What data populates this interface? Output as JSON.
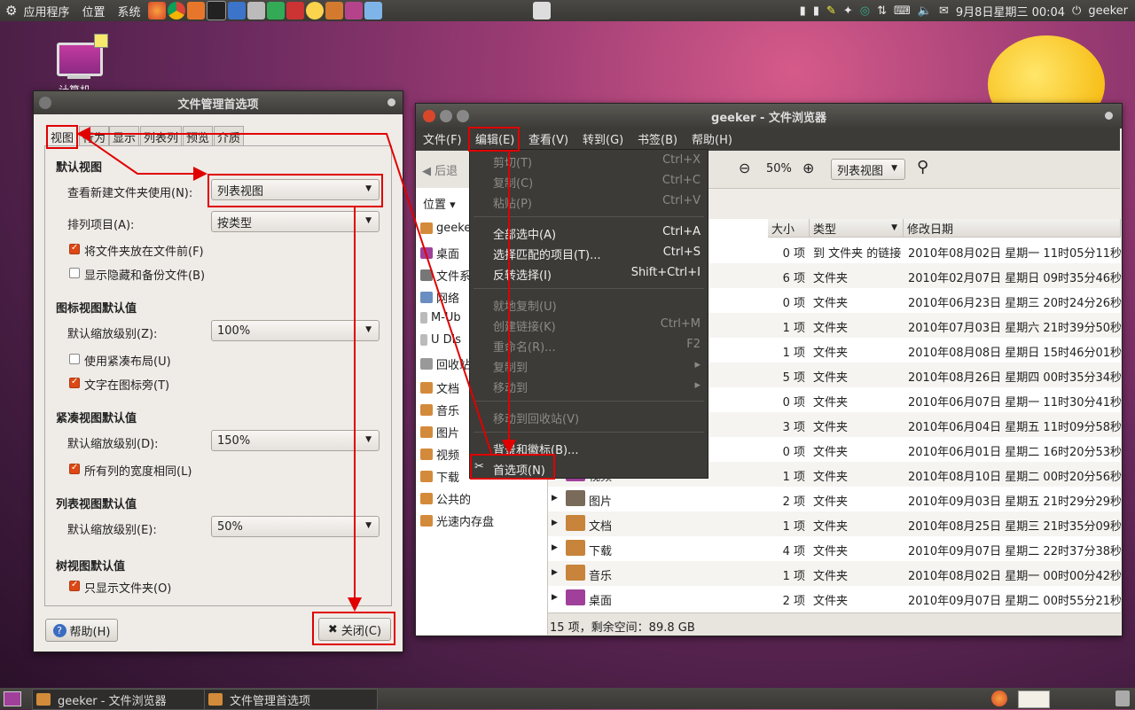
{
  "top_panel": {
    "menus": [
      "应用程序",
      "位置",
      "系统"
    ],
    "clock": "9月8日星期三 00:04",
    "user": "geeker"
  },
  "desktop": {
    "computer_label": "计算机"
  },
  "prefs": {
    "title": "文件管理首选项",
    "tabs": [
      "视图",
      "行为",
      "显示",
      "列表列",
      "预览",
      "介质"
    ],
    "g_default": "默认视图",
    "new_folder_label": "查看新建文件夹使用(N):",
    "new_folder_value": "列表视图",
    "sort_label": "排列项目(A):",
    "sort_value": "按类型",
    "folders_first": "将文件夹放在文件前(F)",
    "show_hidden": "显示隐藏和备份文件(B)",
    "g_icon": "图标视图默认值",
    "icon_zoom_label": "默认缩放级别(Z):",
    "icon_zoom_value": "100%",
    "compact": "使用紧凑布局(U)",
    "text_beside": "文字在图标旁(T)",
    "g_compact": "紧凑视图默认值",
    "compact_zoom_label": "默认缩放级别(D):",
    "compact_zoom_value": "150%",
    "same_width": "所有列的宽度相同(L)",
    "g_list": "列表视图默认值",
    "list_zoom_label": "默认缩放级别(E):",
    "list_zoom_value": "50%",
    "g_tree": "树视图默认值",
    "folders_only": "只显示文件夹(O)",
    "help": "帮助(H)",
    "close": "关闭(C)"
  },
  "browser": {
    "title": "geeker - 文件浏览器",
    "menubar": [
      "文件(F)",
      "编辑(E)",
      "查看(V)",
      "转到(G)",
      "书签(B)",
      "帮助(H)"
    ],
    "back": "后退",
    "zoom": "50%",
    "view_mode": "列表视图",
    "places_label": "位置",
    "sidebar": [
      "geeker",
      "桌面",
      "文件系统",
      "网络",
      "M-Ub",
      "U Dis",
      "回收站",
      "文档",
      "音乐",
      "图片",
      "视频",
      "下载",
      "公共的",
      "光速内存盘"
    ],
    "columns": [
      "大小",
      "类型",
      "修改日期"
    ],
    "rows": [
      {
        "name": "",
        "size": "0 项",
        "type": "到 文件夹 的链接",
        "date": "2010年08月02日 星期一 11时05分11秒"
      },
      {
        "name": "",
        "size": "6 项",
        "type": "文件夹",
        "date": "2010年02月07日 星期日 09时35分46秒"
      },
      {
        "name": "",
        "size": "0 项",
        "type": "文件夹",
        "date": "2010年06月23日 星期三 20时24分26秒"
      },
      {
        "name": "",
        "size": "1 项",
        "type": "文件夹",
        "date": "2010年07月03日 星期六 21时39分50秒"
      },
      {
        "name": "",
        "size": "1 项",
        "type": "文件夹",
        "date": "2010年08月08日 星期日 15时46分01秒"
      },
      {
        "name": "",
        "size": "5 项",
        "type": "文件夹",
        "date": "2010年08月26日 星期四 00时35分34秒"
      },
      {
        "name": "",
        "size": "0 项",
        "type": "文件夹",
        "date": "2010年06月07日 星期一 11时30分41秒"
      },
      {
        "name": "",
        "size": "3 项",
        "type": "文件夹",
        "date": "2010年06月04日 星期五 11时09分58秒"
      },
      {
        "name": "",
        "size": "0 项",
        "type": "文件夹",
        "date": "2010年06月01日 星期二 16时20分53秒"
      },
      {
        "name": "视频",
        "size": "1 项",
        "type": "文件夹",
        "date": "2010年08月10日 星期二 00时20分56秒"
      },
      {
        "name": "图片",
        "size": "2 项",
        "type": "文件夹",
        "date": "2010年09月03日 星期五 21时29分29秒"
      },
      {
        "name": "文档",
        "size": "1 项",
        "type": "文件夹",
        "date": "2010年08月25日 星期三 21时35分09秒"
      },
      {
        "name": "下载",
        "size": "4 项",
        "type": "文件夹",
        "date": "2010年09月07日 星期二 22时37分38秒"
      },
      {
        "name": "音乐",
        "size": "1 项",
        "type": "文件夹",
        "date": "2010年08月02日 星期一 00时00分42秒"
      },
      {
        "name": "桌面",
        "size": "2 项",
        "type": "文件夹",
        "date": "2010年09月07日 星期二 00时55分21秒"
      }
    ],
    "status": "15 项，剩余空间：89.8 GB"
  },
  "edit_menu": {
    "cut": "剪切(T)",
    "cut_k": "Ctrl+X",
    "copy": "复制(C)",
    "copy_k": "Ctrl+C",
    "paste": "粘贴(P)",
    "paste_k": "Ctrl+V",
    "select_all": "全部选中(A)",
    "select_all_k": "Ctrl+A",
    "select_match": "选择匹配的项目(T)...",
    "select_match_k": "Ctrl+S",
    "invert": "反转选择(I)",
    "invert_k": "Shift+Ctrl+I",
    "duplicate": "就地复制(U)",
    "link": "创建链接(K)",
    "link_k": "Ctrl+M",
    "rename": "重命名(R)...",
    "rename_k": "F2",
    "copy_to": "复制到",
    "move_to": "移动到",
    "trash": "移动到回收站(V)",
    "backgrounds": "背景和徽标(B)...",
    "preferences": "首选项(N)"
  },
  "taskbar": [
    "geeker - 文件浏览器",
    "文件管理首选项"
  ]
}
